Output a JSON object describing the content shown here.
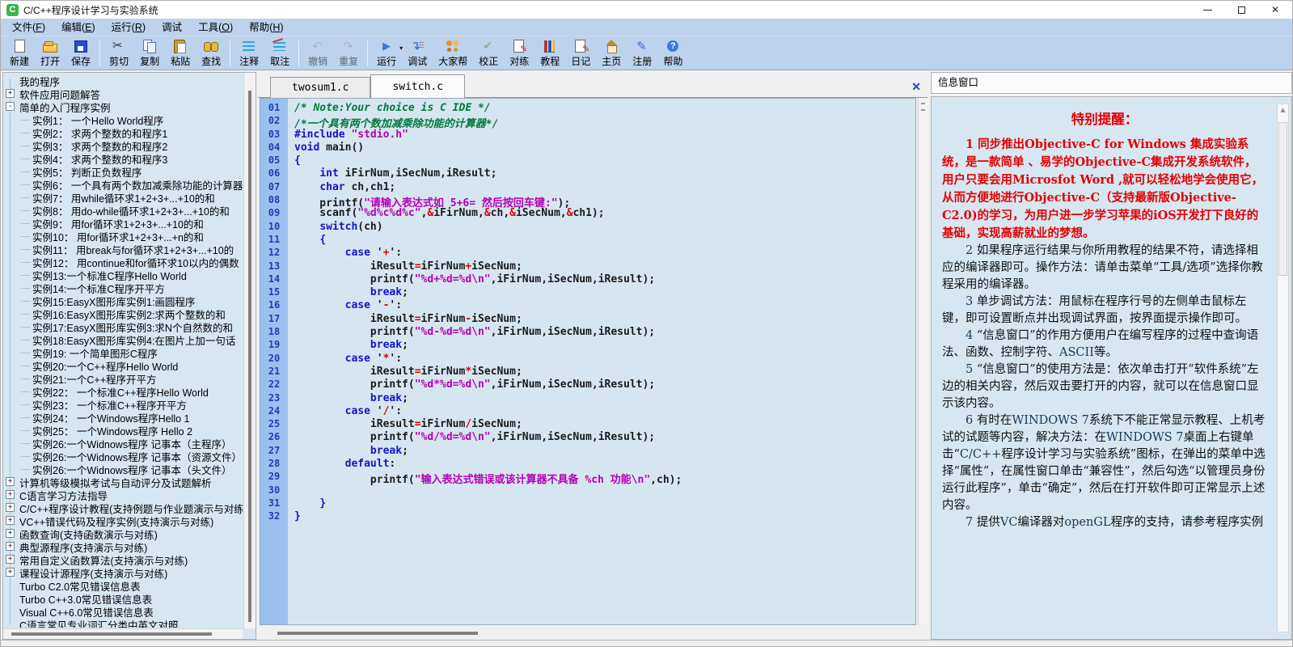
{
  "colors": {
    "toolbar-bg": "#bdd2ec",
    "panel-bg": "#d6e7f1",
    "code-bg": "#d6e6f0",
    "gutter-bg": "#9ac1ee",
    "lineno": "#1f3faf",
    "kw": "#1414c8",
    "cm": "#007a3d",
    "str": "#b400b4",
    "op": "#e00000",
    "red": "#e50000",
    "navy": "#17365d"
  },
  "window": {
    "title": "C/C++程序设计学习与实验系统",
    "icon_letter": "C"
  },
  "menubar": {
    "items": [
      {
        "name": "file",
        "text": "文件",
        "key": "F"
      },
      {
        "name": "edit",
        "text": "编辑",
        "key": "E"
      },
      {
        "name": "run",
        "text": "运行",
        "key": "R"
      },
      {
        "name": "debug",
        "text": "调试",
        "key": null
      },
      {
        "name": "tools",
        "text": "工具",
        "key": "O"
      },
      {
        "name": "help",
        "text": "帮助",
        "key": "H"
      }
    ]
  },
  "toolbar": {
    "buttons": [
      {
        "label": "新建",
        "icon": "new-file",
        "enabled": true
      },
      {
        "label": "打开",
        "icon": "open-folder",
        "enabled": true
      },
      {
        "label": "保存",
        "icon": "save-disk",
        "enabled": true,
        "sep_after": true
      },
      {
        "label": "剪切",
        "icon": "cut-scissors",
        "enabled": true
      },
      {
        "label": "复制",
        "icon": "copy-pages",
        "enabled": true
      },
      {
        "label": "粘贴",
        "icon": "paste-clipboard",
        "enabled": true
      },
      {
        "label": "查找",
        "icon": "find-binoculars",
        "enabled": true,
        "sep_after": true
      },
      {
        "label": "注释",
        "icon": "comment-lines",
        "enabled": true
      },
      {
        "label": "取注",
        "icon": "uncomment-lines",
        "enabled": true,
        "sep_after": true
      },
      {
        "label": "撤销",
        "icon": "undo-arrow",
        "enabled": false
      },
      {
        "label": "重复",
        "icon": "redo-arrow",
        "enabled": false,
        "sep_after": true
      },
      {
        "label": "运行",
        "icon": "run-play",
        "enabled": true,
        "dropdown": true
      },
      {
        "label": "调试",
        "icon": "debug-step",
        "enabled": true
      },
      {
        "label": "大家帮",
        "icon": "people-help",
        "enabled": true
      },
      {
        "label": "校正",
        "icon": "check-mark",
        "enabled": true
      },
      {
        "label": "对练",
        "icon": "practice-edit",
        "enabled": true
      },
      {
        "label": "教程",
        "icon": "tutorial-books",
        "enabled": true
      },
      {
        "label": "日记",
        "icon": "diary-note",
        "enabled": true
      },
      {
        "label": "主页",
        "icon": "home-house",
        "enabled": true
      },
      {
        "label": "注册",
        "icon": "register-pen",
        "enabled": true
      },
      {
        "label": "帮助",
        "icon": "help-question",
        "enabled": true
      }
    ]
  },
  "sidebar": {
    "items": [
      {
        "l": 0,
        "e": "",
        "t": "我的程序"
      },
      {
        "l": 0,
        "e": "+",
        "t": "软件应用问题解答"
      },
      {
        "l": 0,
        "e": "-",
        "t": "简单的入门程序实例"
      },
      {
        "l": 1,
        "e": "",
        "t": "实例1： 一个Hello World程序"
      },
      {
        "l": 1,
        "e": "",
        "t": "实例2： 求两个整数的和程序1"
      },
      {
        "l": 1,
        "e": "",
        "t": "实例3： 求两个整数的和程序2"
      },
      {
        "l": 1,
        "e": "",
        "t": "实例4： 求两个整数的和程序3"
      },
      {
        "l": 1,
        "e": "",
        "t": "实例5： 判断正负数程序"
      },
      {
        "l": 1,
        "e": "",
        "t": "实例6： 一个具有两个数加减乘除功能的计算器"
      },
      {
        "l": 1,
        "e": "",
        "t": "实例7： 用while循环求1+2+3+...+10的和"
      },
      {
        "l": 1,
        "e": "",
        "t": "实例8： 用do-while循环求1+2+3+...+10的和"
      },
      {
        "l": 1,
        "e": "",
        "t": "实例9： 用for循环求1+2+3+...+10的和"
      },
      {
        "l": 1,
        "e": "",
        "t": "实例10： 用for循环求1+2+3+...+n的和"
      },
      {
        "l": 1,
        "e": "",
        "t": "实例11： 用break与for循环求1+2+3+...+10的"
      },
      {
        "l": 1,
        "e": "",
        "t": "实例12： 用continue和for循环求10以内的偶数"
      },
      {
        "l": 1,
        "e": "",
        "t": "实例13:一个标准C程序Hello World"
      },
      {
        "l": 1,
        "e": "",
        "t": "实例14:一个标准C程序开平方"
      },
      {
        "l": 1,
        "e": "",
        "t": "实例15:EasyX图形库实例1:画圆程序"
      },
      {
        "l": 1,
        "e": "",
        "t": "实例16:EasyX图形库实例2:求两个整数的和"
      },
      {
        "l": 1,
        "e": "",
        "t": "实例17:EasyX图形库实例3:求N个自然数的和"
      },
      {
        "l": 1,
        "e": "",
        "t": "实例18:EasyX图形库实例4:在图片上加一句话"
      },
      {
        "l": 1,
        "e": "",
        "t": "实例19: 一个简单图形C程序"
      },
      {
        "l": 1,
        "e": "",
        "t": "实例20:一个C++程序Hello World"
      },
      {
        "l": 1,
        "e": "",
        "t": "实例21:一个C++程序开平方"
      },
      {
        "l": 1,
        "e": "",
        "t": "实例22： 一个标准C++程序Hello World"
      },
      {
        "l": 1,
        "e": "",
        "t": "实例23： 一个标准C++程序开平方"
      },
      {
        "l": 1,
        "e": "",
        "t": "实例24： 一个Windows程序Hello 1"
      },
      {
        "l": 1,
        "e": "",
        "t": "实例25： 一个Windows程序 Hello 2"
      },
      {
        "l": 1,
        "e": "",
        "t": "实例26:一个Widnows程序 记事本（主程序）"
      },
      {
        "l": 1,
        "e": "",
        "t": "实例26:一个Widnows程序 记事本（资源文件）"
      },
      {
        "l": 1,
        "e": "",
        "t": "实例26:一个Widnows程序 记事本（头文件）"
      },
      {
        "l": 0,
        "e": "+",
        "t": "计算机等级模拟考试与自动评分及试题解析"
      },
      {
        "l": 0,
        "e": "+",
        "t": "C语言学习方法指导"
      },
      {
        "l": 0,
        "e": "+",
        "t": "C/C++程序设计教程(支持例题与作业题演示与对练)"
      },
      {
        "l": 0,
        "e": "+",
        "t": "VC++错误代码及程序实例(支持演示与对练)"
      },
      {
        "l": 0,
        "e": "+",
        "t": "函数查询(支持函数演示与对练)"
      },
      {
        "l": 0,
        "e": "+",
        "t": "典型源程序(支持演示与对练)"
      },
      {
        "l": 0,
        "e": "+",
        "t": "常用自定义函数算法(支持演示与对练)"
      },
      {
        "l": 0,
        "e": "+",
        "t": "课程设计源程序(支持演示与对练)"
      },
      {
        "l": 0,
        "e": "",
        "t": "Turbo C2.0常见错误信息表"
      },
      {
        "l": 0,
        "e": "",
        "t": "Turbo C++3.0常见错误信息表"
      },
      {
        "l": 0,
        "e": "",
        "t": "Visual C++6.0常见错误信息表"
      },
      {
        "l": 0,
        "e": "",
        "t": "C语言常见专业词汇分类中英文对照"
      }
    ]
  },
  "editor": {
    "tabs": [
      {
        "label": "twosum1.c",
        "active": false
      },
      {
        "label": "switch.c",
        "active": true
      }
    ],
    "close_label": "✕",
    "lines": [
      {
        "n": "01",
        "s": [
          [
            "cm",
            "/* Note:Your choice is C IDE */"
          ]
        ]
      },
      {
        "n": "02",
        "s": [
          [
            "cm",
            "/*一个具有两个数加减乘除功能的计算器*/"
          ]
        ]
      },
      {
        "n": "03",
        "s": [
          [
            "kw",
            "#include"
          ],
          [
            "pl",
            " "
          ],
          [
            "str",
            "\"stdio.h\""
          ]
        ]
      },
      {
        "n": "04",
        "s": [
          [
            "kw",
            "void"
          ],
          [
            "pl",
            " main()"
          ]
        ]
      },
      {
        "n": "05",
        "s": [
          [
            "kw",
            "{"
          ]
        ]
      },
      {
        "n": "06",
        "s": [
          [
            "pl",
            "    "
          ],
          [
            "kw",
            "int"
          ],
          [
            "pl",
            " iFirNum,iSecNum,iResult;"
          ]
        ]
      },
      {
        "n": "07",
        "s": [
          [
            "pl",
            "    "
          ],
          [
            "kw",
            "char"
          ],
          [
            "pl",
            " ch,ch1;"
          ]
        ]
      },
      {
        "n": "08",
        "s": [
          [
            "pl",
            "    printf("
          ],
          [
            "str",
            "\"请输入表达式如 5+6= 然后按回车键:\""
          ],
          [
            "pl",
            ");"
          ]
        ]
      },
      {
        "n": "09",
        "s": [
          [
            "pl",
            "    scanf("
          ],
          [
            "str",
            "\"%d%c%d%c\""
          ],
          [
            "pl",
            ","
          ],
          [
            "op",
            "&"
          ],
          [
            "pl",
            "iFirNum,"
          ],
          [
            "op",
            "&"
          ],
          [
            "pl",
            "ch,"
          ],
          [
            "op",
            "&"
          ],
          [
            "pl",
            "iSecNum,"
          ],
          [
            "op",
            "&"
          ],
          [
            "pl",
            "ch1);"
          ]
        ]
      },
      {
        "n": "10",
        "s": [
          [
            "pl",
            "    "
          ],
          [
            "kw",
            "switch"
          ],
          [
            "pl",
            "(ch)"
          ]
        ]
      },
      {
        "n": "11",
        "s": [
          [
            "pl",
            "    "
          ],
          [
            "kw",
            "{"
          ]
        ]
      },
      {
        "n": "12",
        "s": [
          [
            "pl",
            "        "
          ],
          [
            "kw",
            "case"
          ],
          [
            "pl",
            " '"
          ],
          [
            "op",
            "+"
          ],
          [
            "pl",
            "':"
          ]
        ]
      },
      {
        "n": "13",
        "s": [
          [
            "pl",
            "            iResult"
          ],
          [
            "op",
            "="
          ],
          [
            "pl",
            "iFirNum"
          ],
          [
            "op",
            "+"
          ],
          [
            "pl",
            "iSecNum;"
          ]
        ]
      },
      {
        "n": "14",
        "s": [
          [
            "pl",
            "            printf("
          ],
          [
            "str",
            "\"%d+%d=%d\\n\""
          ],
          [
            "pl",
            ",iFirNum,iSecNum,iResult);"
          ]
        ]
      },
      {
        "n": "15",
        "s": [
          [
            "pl",
            "            "
          ],
          [
            "kw",
            "break"
          ],
          [
            "pl",
            ";"
          ]
        ]
      },
      {
        "n": "16",
        "s": [
          [
            "pl",
            "        "
          ],
          [
            "kw",
            "case"
          ],
          [
            "pl",
            " '"
          ],
          [
            "op",
            "-"
          ],
          [
            "pl",
            "':"
          ]
        ]
      },
      {
        "n": "17",
        "s": [
          [
            "pl",
            "            iResult"
          ],
          [
            "op",
            "="
          ],
          [
            "pl",
            "iFirNum"
          ],
          [
            "op",
            "-"
          ],
          [
            "pl",
            "iSecNum;"
          ]
        ]
      },
      {
        "n": "18",
        "s": [
          [
            "pl",
            "            printf("
          ],
          [
            "str",
            "\"%d-%d=%d\\n\""
          ],
          [
            "pl",
            ",iFirNum,iSecNum,iResult);"
          ]
        ]
      },
      {
        "n": "19",
        "s": [
          [
            "pl",
            "            "
          ],
          [
            "kw",
            "break"
          ],
          [
            "pl",
            ";"
          ]
        ]
      },
      {
        "n": "20",
        "s": [
          [
            "pl",
            "        "
          ],
          [
            "kw",
            "case"
          ],
          [
            "pl",
            " '"
          ],
          [
            "op",
            "*"
          ],
          [
            "pl",
            "':"
          ]
        ]
      },
      {
        "n": "21",
        "s": [
          [
            "pl",
            "            iResult"
          ],
          [
            "op",
            "="
          ],
          [
            "pl",
            "iFirNum"
          ],
          [
            "op",
            "*"
          ],
          [
            "pl",
            "iSecNum;"
          ]
        ]
      },
      {
        "n": "22",
        "s": [
          [
            "pl",
            "            printf("
          ],
          [
            "str",
            "\"%d*%d=%d\\n\""
          ],
          [
            "pl",
            ",iFirNum,iSecNum,iResult);"
          ]
        ]
      },
      {
        "n": "23",
        "s": [
          [
            "pl",
            "            "
          ],
          [
            "kw",
            "break"
          ],
          [
            "pl",
            ";"
          ]
        ]
      },
      {
        "n": "24",
        "s": [
          [
            "pl",
            "        "
          ],
          [
            "kw",
            "case"
          ],
          [
            "pl",
            " '"
          ],
          [
            "op",
            "/"
          ],
          [
            "pl",
            "':"
          ]
        ]
      },
      {
        "n": "25",
        "s": [
          [
            "pl",
            "            iResult"
          ],
          [
            "op",
            "="
          ],
          [
            "pl",
            "iFirNum"
          ],
          [
            "op",
            "/"
          ],
          [
            "pl",
            "iSecNum;"
          ]
        ]
      },
      {
        "n": "26",
        "s": [
          [
            "pl",
            "            printf("
          ],
          [
            "str",
            "\"%d/%d=%d\\n\""
          ],
          [
            "pl",
            ",iFirNum,iSecNum,iResult);"
          ]
        ]
      },
      {
        "n": "27",
        "s": [
          [
            "pl",
            "            "
          ],
          [
            "kw",
            "break"
          ],
          [
            "pl",
            ";"
          ]
        ]
      },
      {
        "n": "28",
        "s": [
          [
            "pl",
            "        "
          ],
          [
            "kw",
            "default"
          ],
          [
            "pl",
            ":"
          ]
        ]
      },
      {
        "n": "29",
        "s": [
          [
            "pl",
            "            printf("
          ],
          [
            "str",
            "\"输入表达式错误或该计算器不具备 %ch 功能\\n\""
          ],
          [
            "pl",
            ",ch);"
          ]
        ]
      },
      {
        "n": "30",
        "s": []
      },
      {
        "n": "31",
        "s": [
          [
            "pl",
            "    "
          ],
          [
            "kw",
            "}"
          ]
        ]
      },
      {
        "n": "32",
        "s": [
          [
            "kw",
            "}"
          ]
        ]
      }
    ]
  },
  "info": {
    "header": "信息窗口",
    "title": "特别提醒：",
    "paragraphs": [
      {
        "segs": [
          [
            "r",
            "1 同步推出Objective-C for Windows 集成实验系统，是一款简单 、易学的Objective-C集成开发系统软件，用户只要会用Microsfot Word ,就可以轻松地学会使用它，从而方便地进行Objective-C（支持最新版Objective-C2.0)的学习，为用户进一步学习苹果的iOS开发打下良好的基础，实现高薪就业的梦想。"
          ]
        ]
      },
      {
        "segs": [
          [
            "b",
            "2"
          ],
          [
            "n",
            " 如果程序运行结果与你所用教程的结果不符，请选择相应的编译器即可。操作方法：请单击菜单“工具/选项”选择你教程采用的编译器。"
          ]
        ]
      },
      {
        "segs": [
          [
            "b",
            "3"
          ],
          [
            "n",
            " 单步调试方法：用鼠标在程序行号的左侧单击鼠标左键，即可设置断点并出现调试界面，按界面提示操作即可。"
          ]
        ]
      },
      {
        "segs": [
          [
            "b",
            "4"
          ],
          [
            "n",
            " “信息窗口”的作用方便用户在编写程序的过程中查询语法、函数、控制字符、"
          ],
          [
            "b",
            "ASCII"
          ],
          [
            "n",
            "等。"
          ]
        ]
      },
      {
        "segs": [
          [
            "b",
            "5"
          ],
          [
            "n",
            " “信息窗口”的使用方法是：依次单击打开“软件系统”左边的相关内容，然后双击要打开的内容，就可以在信息窗口显示该内容。"
          ]
        ]
      },
      {
        "segs": [
          [
            "b",
            "6"
          ],
          [
            "n",
            " 有时在"
          ],
          [
            "b",
            "WINDOWS 7"
          ],
          [
            "n",
            "系统下不能正常显示教程、上机考试的试题等内容，解决方法：在"
          ],
          [
            "b",
            "WINDOWS 7"
          ],
          [
            "n",
            "桌面上右键单击“"
          ],
          [
            "b",
            "C/C++"
          ],
          [
            "n",
            "程序设计学习与实验系统”图标，在弹出的菜单中选择“属性”，在属性窗口单击“兼容性”，然后勾选“以管理员身份运行此程序”，单击“确定”，然后在打开软件即可正常显示上述内容。"
          ]
        ]
      },
      {
        "segs": [
          [
            "b",
            "7"
          ],
          [
            "n",
            " 提供"
          ],
          [
            "b",
            "VC"
          ],
          [
            "n",
            "编译器对"
          ],
          [
            "b",
            "openGL"
          ],
          [
            "n",
            "程序的支持，请参考程序实例"
          ]
        ]
      }
    ]
  }
}
